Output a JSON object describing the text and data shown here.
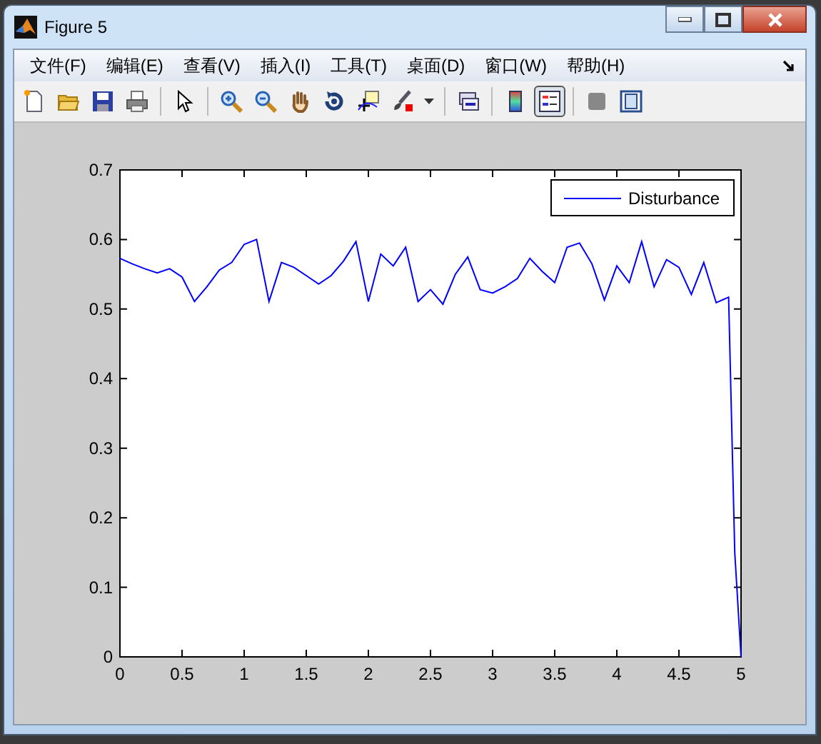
{
  "window": {
    "title": "Figure 5"
  },
  "menu": [
    {
      "label": "文件(F)"
    },
    {
      "label": "编辑(E)"
    },
    {
      "label": "查看(V)"
    },
    {
      "label": "插入(I)"
    },
    {
      "label": "工具(T)"
    },
    {
      "label": "桌面(D)"
    },
    {
      "label": "窗口(W)"
    },
    {
      "label": "帮助(H)"
    }
  ],
  "toolbar": [
    {
      "kind": "new",
      "pressed": false
    },
    {
      "kind": "open",
      "pressed": false
    },
    {
      "kind": "save",
      "pressed": false
    },
    {
      "kind": "print",
      "pressed": false
    },
    {
      "kind": "separator"
    },
    {
      "kind": "pointer",
      "pressed": false
    },
    {
      "kind": "separator"
    },
    {
      "kind": "zoom-in",
      "pressed": false
    },
    {
      "kind": "zoom-out",
      "pressed": false
    },
    {
      "kind": "pan",
      "pressed": false
    },
    {
      "kind": "rotate",
      "pressed": false
    },
    {
      "kind": "data-cursor",
      "pressed": false
    },
    {
      "kind": "brush",
      "pressed": false
    },
    {
      "kind": "dropdown"
    },
    {
      "kind": "separator"
    },
    {
      "kind": "link",
      "pressed": false
    },
    {
      "kind": "separator"
    },
    {
      "kind": "colorbar",
      "pressed": false
    },
    {
      "kind": "legend",
      "pressed": true
    },
    {
      "kind": "separator"
    },
    {
      "kind": "hide-tools",
      "pressed": false
    },
    {
      "kind": "show-tools",
      "pressed": false
    }
  ],
  "plot": {
    "chart_data": {
      "type": "line",
      "x": [
        0,
        0.1,
        0.2,
        0.3,
        0.4,
        0.5,
        0.6,
        0.7,
        0.8,
        0.9,
        1,
        1.1,
        1.2,
        1.3,
        1.4,
        1.5,
        1.6,
        1.7,
        1.8,
        1.9,
        2,
        2.1,
        2.2,
        2.3,
        2.4,
        2.5,
        2.6,
        2.7,
        2.8,
        2.9,
        3,
        3.1,
        3.2,
        3.3,
        3.4,
        3.5,
        3.6,
        3.7,
        3.8,
        3.9,
        4,
        4.1,
        4.2,
        4.3,
        4.4,
        4.5,
        4.6,
        4.7,
        4.8,
        4.9,
        4.95,
        5
      ],
      "series": [
        {
          "name": "Disturbance",
          "color": "#0000ff",
          "values": [
            0.573,
            0.565,
            0.558,
            0.552,
            0.558,
            0.546,
            0.511,
            0.532,
            0.556,
            0.567,
            0.593,
            0.6,
            0.511,
            0.567,
            0.56,
            0.548,
            0.536,
            0.548,
            0.569,
            0.597,
            0.511,
            0.579,
            0.562,
            0.589,
            0.511,
            0.528,
            0.507,
            0.55,
            0.575,
            0.528,
            0.523,
            0.532,
            0.544,
            0.573,
            0.554,
            0.538,
            0.589,
            0.595,
            0.565,
            0.513,
            0.562,
            0.538,
            0.597,
            0.532,
            0.571,
            0.56,
            0.521,
            0.567,
            0.509,
            0.517,
            0.15,
            0
          ]
        }
      ],
      "xlim": [
        0,
        5
      ],
      "ylim": [
        0,
        0.7
      ],
      "xticks": [
        {
          "value": 0,
          "label": "0"
        },
        {
          "value": 0.5,
          "label": "0.5"
        },
        {
          "value": 1,
          "label": "1"
        },
        {
          "value": 1.5,
          "label": "1.5"
        },
        {
          "value": 2,
          "label": "2"
        },
        {
          "value": 2.5,
          "label": "2.5"
        },
        {
          "value": 3,
          "label": "3"
        },
        {
          "value": 3.5,
          "label": "3.5"
        },
        {
          "value": 4,
          "label": "4"
        },
        {
          "value": 4.5,
          "label": "4.5"
        },
        {
          "value": 5,
          "label": "5"
        }
      ],
      "yticks": [
        {
          "value": 0,
          "label": "0"
        },
        {
          "value": 0.1,
          "label": "0.1"
        },
        {
          "value": 0.2,
          "label": "0.2"
        },
        {
          "value": 0.3,
          "label": "0.3"
        },
        {
          "value": 0.4,
          "label": "0.4"
        },
        {
          "value": 0.5,
          "label": "0.5"
        },
        {
          "value": 0.6,
          "label": "0.6"
        },
        {
          "value": 0.7,
          "label": "0.7"
        }
      ]
    }
  }
}
